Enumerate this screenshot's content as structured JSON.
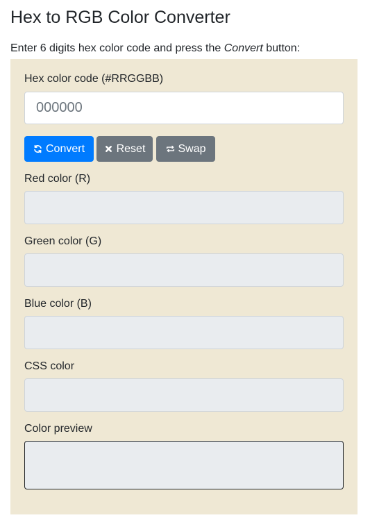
{
  "header": {
    "title": "Hex to RGB Color Converter"
  },
  "intro": {
    "before": "Enter 6 digits hex color code and press the ",
    "emphasis": "Convert",
    "after": " button:"
  },
  "form": {
    "hex_label": "Hex color code (#RRGGBB)",
    "hex_placeholder": "000000",
    "hex_value": "",
    "buttons": {
      "convert": {
        "label": "Convert",
        "icon": "refresh-icon"
      },
      "reset": {
        "label": "Reset",
        "icon": "close-icon"
      },
      "swap": {
        "label": "Swap",
        "icon": "swap-icon"
      }
    },
    "outputs": {
      "red_label": "Red color (R)",
      "red_value": "",
      "green_label": "Green color (G)",
      "green_value": "",
      "blue_label": "Blue color (B)",
      "blue_value": "",
      "css_label": "CSS color",
      "css_value": "",
      "preview_label": "Color preview"
    }
  },
  "colors": {
    "panel_background": "#efe8d4",
    "primary_button": "#007bff",
    "secondary_button": "#6c757d",
    "readonly_field": "#e9ecef"
  }
}
